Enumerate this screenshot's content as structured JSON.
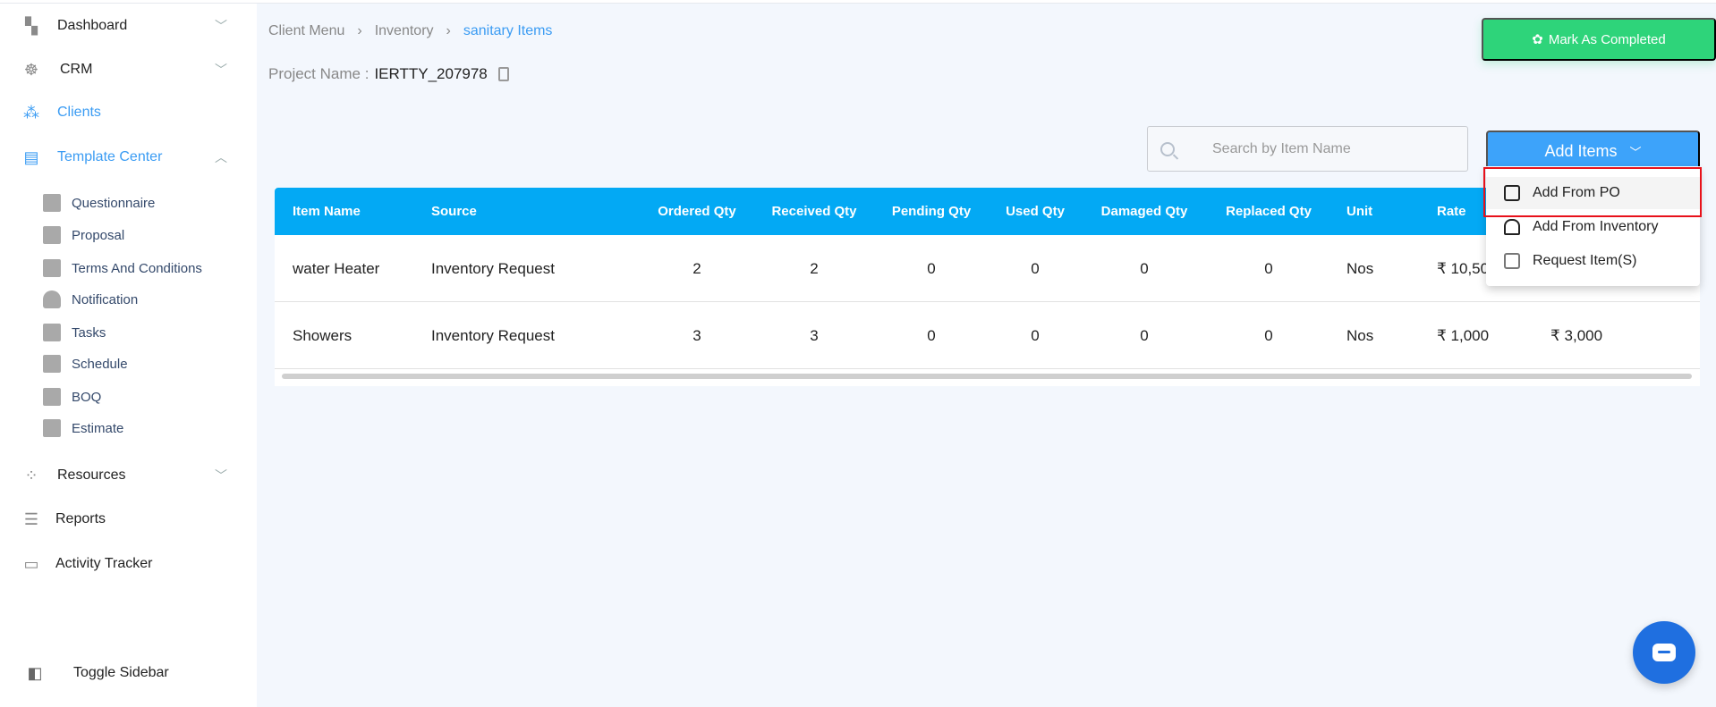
{
  "sidebar": {
    "dashboard": "Dashboard",
    "crm": "CRM",
    "clients": "Clients",
    "template_center": "Template Center",
    "sub_items": [
      "Questionnaire",
      "Proposal",
      "Terms And Conditions",
      "Notification",
      "Tasks",
      "Schedule",
      "BOQ",
      "Estimate"
    ],
    "resources": "Resources",
    "reports": "Reports",
    "activity_tracker": "Activity Tracker",
    "toggle": "Toggle Sidebar"
  },
  "breadcrumb": [
    "Client Menu",
    "Inventory",
    "sanitary Items"
  ],
  "project": {
    "label": "Project Name :",
    "value": "IERTTY_207978"
  },
  "mark_completed": "Mark As Completed",
  "search": {
    "placeholder": "Search by Item Name",
    "value": ""
  },
  "add_items": {
    "label": "Add Items",
    "options": [
      "Add From PO",
      "Add From Inventory",
      "Request Item(S)"
    ]
  },
  "table": {
    "headers": [
      "Item Name",
      "Source",
      "Ordered Qty",
      "Received Qty",
      "Pending Qty",
      "Used Qty",
      "Damaged Qty",
      "Replaced Qty",
      "Unit",
      "Rate"
    ],
    "rows": [
      {
        "name": "water Heater",
        "source": "Inventory Request",
        "ordered": "2",
        "received": "2",
        "pending": "0",
        "used": "0",
        "damaged": "0",
        "replaced": "0",
        "unit": "Nos",
        "rate": "₹ 10,500",
        "amount": ""
      },
      {
        "name": "Showers",
        "source": "Inventory Request",
        "ordered": "3",
        "received": "3",
        "pending": "0",
        "used": "0",
        "damaged": "0",
        "replaced": "0",
        "unit": "Nos",
        "rate": "₹ 1,000",
        "amount": "₹ 3,000"
      }
    ]
  },
  "colors": {
    "accent": "#3b9cf3",
    "header": "#03a9f4",
    "success": "#2ed47a",
    "highlight": "#e8111a"
  }
}
